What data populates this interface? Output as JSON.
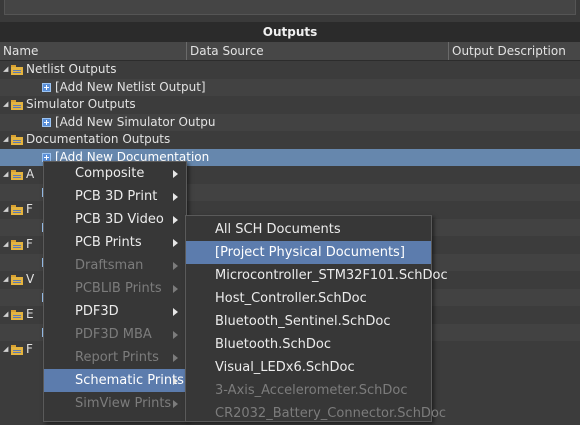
{
  "panel": {
    "title": "Outputs"
  },
  "columns": [
    "Name",
    "Data Source",
    "Output Description"
  ],
  "rows": [
    {
      "type": "group",
      "label": "Netlist Outputs"
    },
    {
      "type": "add",
      "label": "[Add New Netlist Output]"
    },
    {
      "type": "group",
      "label": "Simulator Outputs"
    },
    {
      "type": "add",
      "label": "[Add New Simulator Outpu"
    },
    {
      "type": "group",
      "label": "Documentation Outputs"
    },
    {
      "type": "add",
      "label": "[Add New Documentation",
      "selected": true
    },
    {
      "type": "group",
      "label": "A"
    },
    {
      "type": "add",
      "label": ""
    },
    {
      "type": "group",
      "label": "F"
    },
    {
      "type": "add",
      "label": ""
    },
    {
      "type": "group",
      "label": "F"
    },
    {
      "type": "add",
      "label": ""
    },
    {
      "type": "group",
      "label": "V"
    },
    {
      "type": "add",
      "label": ""
    },
    {
      "type": "group",
      "label": "E"
    },
    {
      "type": "add",
      "label": ""
    },
    {
      "type": "group",
      "label": "F"
    }
  ],
  "menu1": [
    {
      "label": "Composite",
      "accel": "C",
      "rest": "omposite",
      "enabled": true
    },
    {
      "label": "PCB 3D Print",
      "enabled": true
    },
    {
      "label": "PCB 3D Video",
      "enabled": true
    },
    {
      "label": "PCB Prints",
      "enabled": true
    },
    {
      "label": "Draftsman",
      "enabled": false
    },
    {
      "label": "PCBLIB Prints",
      "enabled": false
    },
    {
      "label": "PDF3D",
      "enabled": true
    },
    {
      "label": "PDF3D MBA",
      "enabled": false
    },
    {
      "label": "Report Prints",
      "enabled": false
    },
    {
      "label": "Schematic Prints",
      "enabled": true,
      "highlighted": true
    },
    {
      "label": "SimView Prints",
      "enabled": false
    }
  ],
  "menu2": [
    {
      "label": "All SCH Documents",
      "enabled": true
    },
    {
      "label": "[Project Physical Documents]",
      "enabled": true,
      "highlighted": true
    },
    {
      "label": "Microcontroller_STM32F101.SchDoc",
      "enabled": true
    },
    {
      "label": "Host_Controller.SchDoc",
      "enabled": true
    },
    {
      "label": "Bluetooth_Sentinel.SchDoc",
      "enabled": true
    },
    {
      "label": "Bluetooth.SchDoc",
      "enabled": true
    },
    {
      "label": "Visual_LEDx6.SchDoc",
      "enabled": true
    },
    {
      "label": "3-Axis_Accelerometer.SchDoc",
      "enabled": false
    },
    {
      "label": "CR2032_Battery_Connector.SchDoc",
      "enabled": false
    }
  ],
  "icons": {
    "group": "folder-icon",
    "add": "add-plus-icon",
    "submenu": "submenu-arrow-icon",
    "expand": "collapse-triangle-icon"
  },
  "colors": {
    "selection": "#6687ad",
    "menu_bg": "#373737",
    "menu_highlight": "#5c7cad"
  }
}
